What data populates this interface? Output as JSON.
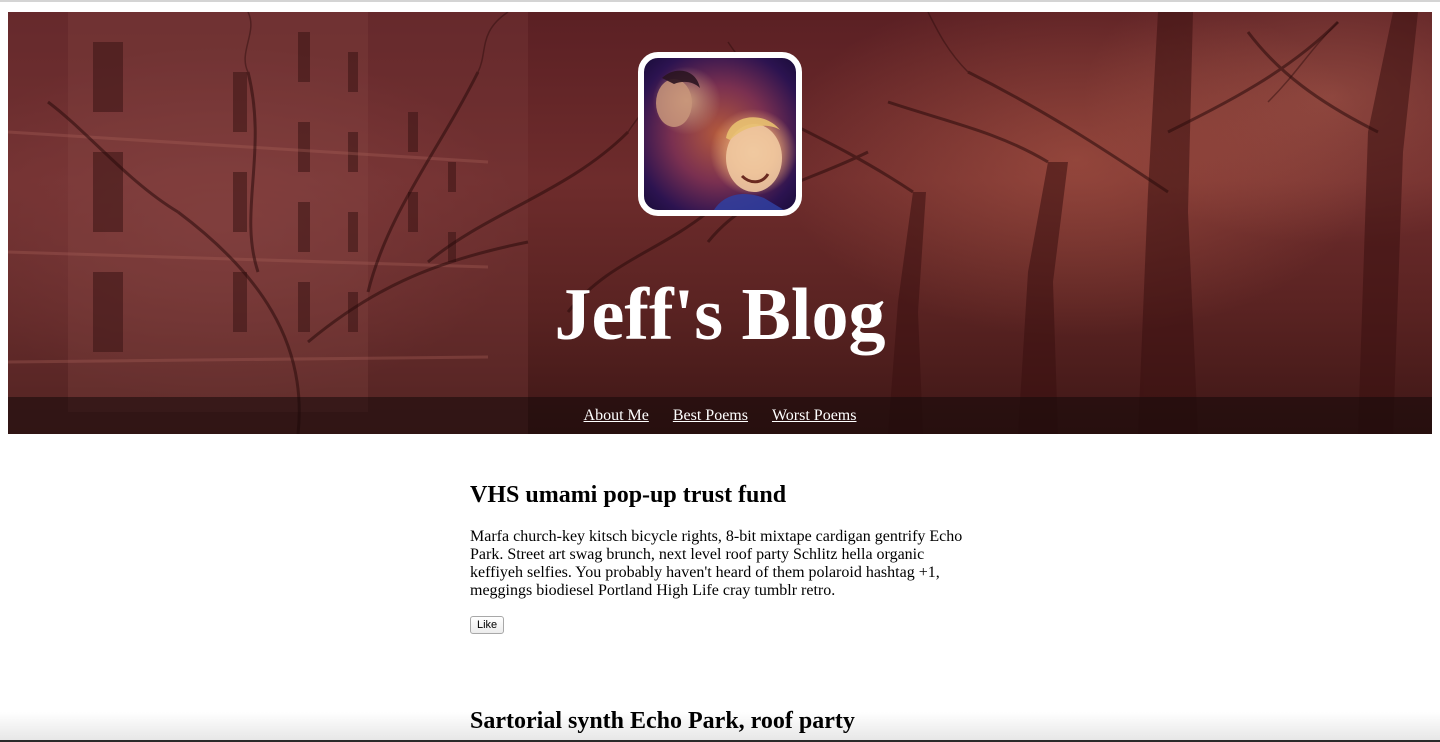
{
  "header": {
    "title": "Jeff's Blog",
    "avatar_icon": "profile-photo-icon"
  },
  "nav": {
    "items": [
      {
        "label": "About Me"
      },
      {
        "label": "Best Poems"
      },
      {
        "label": "Worst Poems"
      }
    ]
  },
  "posts": [
    {
      "title": "VHS umami pop-up trust fund",
      "body": "Marfa church-key kitsch bicycle rights, 8-bit mixtape cardigan gentrify Echo Park. Street art swag brunch, next level roof party Schlitz hella organic keffiyeh selfies. You probably haven't heard of them polaroid hashtag +1, meggings biodiesel Portland High Life cray tumblr retro.",
      "like_label": "Like"
    },
    {
      "title": "Sartorial synth Echo Park, roof party"
    }
  ],
  "colors": {
    "header_tint": "#5b2024",
    "nav_bar": "#140a0a",
    "title_text": "#ffffff",
    "body_text": "#000000"
  }
}
